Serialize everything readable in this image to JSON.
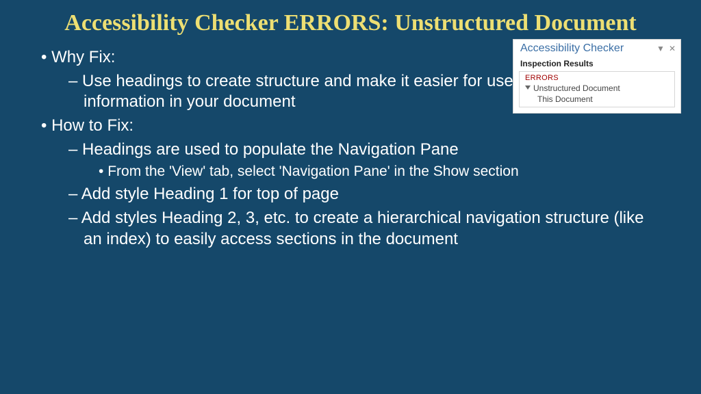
{
  "title": "Accessibility Checker ERRORS: Unstructured Document",
  "bullets": {
    "why_label": "Why Fix:",
    "why_1": "Use headings to create structure and make it easier for users to find information in your document",
    "how_label": "How to Fix:",
    "how_1": "Headings are used to populate the Navigation Pane",
    "how_1a": "From the 'View' tab, select 'Navigation Pane' in the Show section",
    "how_2": "Add style Heading 1 for top of page",
    "how_3": "Add styles Heading 2, 3, etc. to create a hierarchical navigation structure (like an index) to easily access sections in the document"
  },
  "panel": {
    "title": "Accessibility Checker",
    "dropdown": "▼",
    "close": "✕",
    "subtitle": "Inspection Results",
    "errors_label": "ERRORS",
    "item": "Unstructured Document",
    "subitem": "This Document"
  }
}
